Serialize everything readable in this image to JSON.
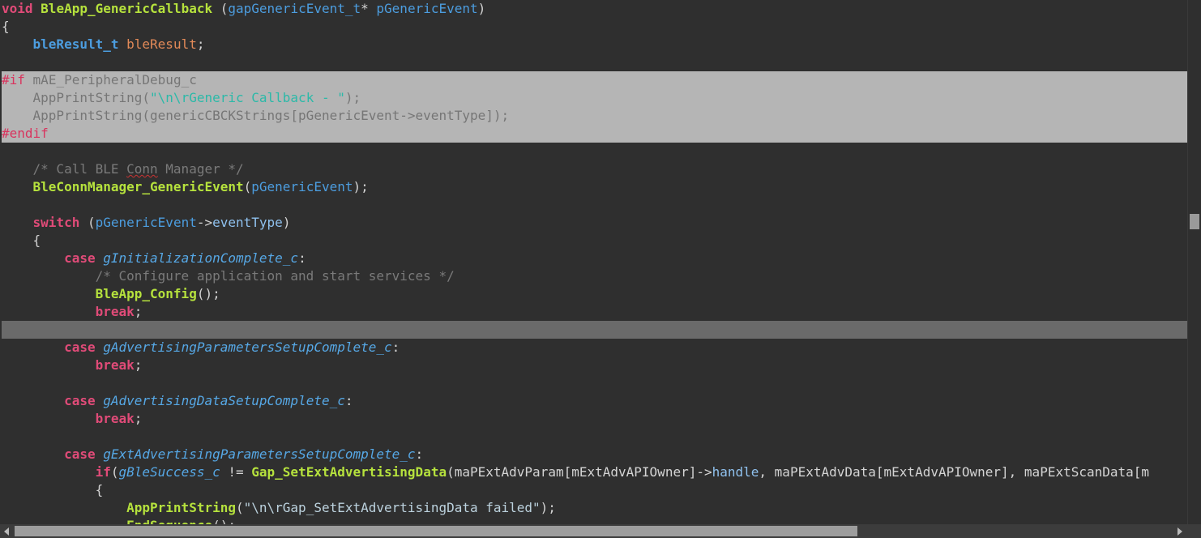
{
  "code": {
    "l1": [
      "void",
      "BleApp_GenericCallback",
      "(",
      "gapGenericEvent_t",
      "* ",
      "pGenericEvent",
      ")"
    ],
    "l2": [
      "{"
    ],
    "l3": [
      "bleResult_t",
      "bleResult",
      ";"
    ],
    "l5": [
      "#if",
      "mAE_PeripheralDebug_c"
    ],
    "l6": [
      "AppPrintString(",
      "\"\\n\\rGeneric Callback - \"",
      ");"
    ],
    "l7": [
      "AppPrintString(genericCBCKStrings[pGenericEvent->eventType]);"
    ],
    "l8": [
      "#endif"
    ],
    "l10": [
      "/* Call BLE ",
      "Conn",
      " Manager */"
    ],
    "l11": [
      "BleConnManager_GenericEvent",
      "(",
      "pGenericEvent",
      ");"
    ],
    "l13": [
      "switch",
      "(",
      "pGenericEvent",
      "->",
      "eventType",
      ")"
    ],
    "l14": [
      "{"
    ],
    "l15": [
      "case",
      "gInitializationComplete_c",
      ":"
    ],
    "l16": [
      "/* Configure application and start services */"
    ],
    "l17": [
      "BleApp_Config",
      "();"
    ],
    "l18": [
      "break",
      ";"
    ],
    "l20": [
      "case",
      "gAdvertisingParametersSetupComplete_c",
      ":"
    ],
    "l21": [
      "break",
      ";"
    ],
    "l23": [
      "case",
      "gAdvertisingDataSetupComplete_c",
      ":"
    ],
    "l24": [
      "break",
      ";"
    ],
    "l26": [
      "case",
      "gExtAdvertisingParametersSetupComplete_c",
      ":"
    ],
    "l27": [
      "if",
      "(",
      "gBleSuccess_c",
      " != ",
      "Gap_SetExtAdvertisingData",
      "(maPExtAdvParam[mExtAdvAPIOwner]->",
      "handle",
      ", maPExtAdvData[mExtAdvAPIOwner], maPExtScanData[",
      "m"
    ],
    "l28": [
      "{"
    ],
    "l29": [
      "AppPrintString",
      "(",
      "\"\\n\\rGap_SetExtAdvertisingData failed\"",
      ");"
    ],
    "l30": [
      "EndSequence",
      "();"
    ]
  }
}
